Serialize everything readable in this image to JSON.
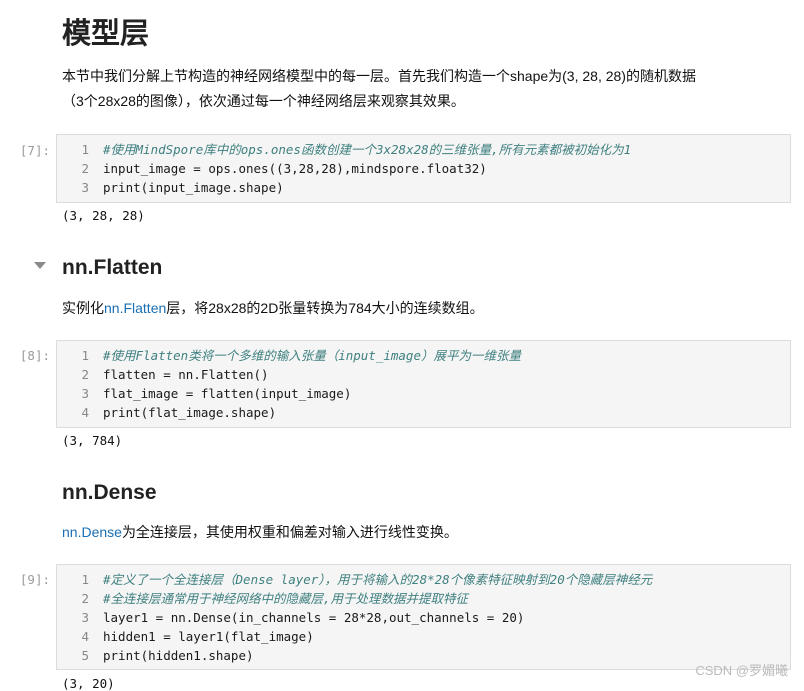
{
  "section": {
    "title": "模型层",
    "intro_line1": "本节中我们分解上节构造的神经网络模型中的每一层。首先我们构造一个shape为(3, 28, 28)的随机数据",
    "intro_line2": "（3个28x28的图像），依次通过每一个神经网络层来观察其效果。"
  },
  "cells": [
    {
      "prompt": "[7]:",
      "line_numbers": [
        "1",
        "2",
        "3"
      ],
      "code": [
        "#使用MindSpore库中的ops.ones函数创建一个3x28x28的三维张量,所有元素都被初始化为1",
        "input_image = ops.ones((3,28,28),mindspore.float32)",
        "print(input_image.shape)"
      ],
      "output": "(3, 28, 28)"
    },
    {
      "prompt": "[8]:",
      "line_numbers": [
        "1",
        "2",
        "3",
        "4"
      ],
      "code": [
        "#使用Flatten类将一个多维的输入张量（input_image）展平为一维张量",
        "flatten = nn.Flatten()",
        "flat_image = flatten(input_image)",
        "print(flat_image.shape)"
      ],
      "output": "(3, 784)"
    },
    {
      "prompt": "[9]:",
      "line_numbers": [
        "1",
        "2",
        "3",
        "4",
        "5"
      ],
      "code": [
        "#定义了一个全连接层（Dense layer），用于将输入的28*28个像素特征映射到20个隐藏层神经元",
        "#全连接层通常用于神经网络中的隐藏层,用于处理数据并提取特征",
        "layer1 = nn.Dense(in_channels = 28*28,out_channels = 20)",
        "hidden1 = layer1(flat_image)",
        "print(hidden1.shape)"
      ],
      "output": "(3, 20)"
    }
  ],
  "flatten_section": {
    "title": "nn.Flatten",
    "desc_prefix": "实例化",
    "desc_link": "nn.Flatten",
    "desc_suffix": "层，将28x28的2D张量转换为784大小的连续数组。"
  },
  "dense_section": {
    "title": "nn.Dense",
    "desc_link": "nn.Dense",
    "desc_suffix": "为全连接层，其使用权重和偏差对输入进行线性变换。"
  },
  "watermark": "CSDN @罗媚曦",
  "icons": {
    "collapse": "caret-down-icon"
  }
}
